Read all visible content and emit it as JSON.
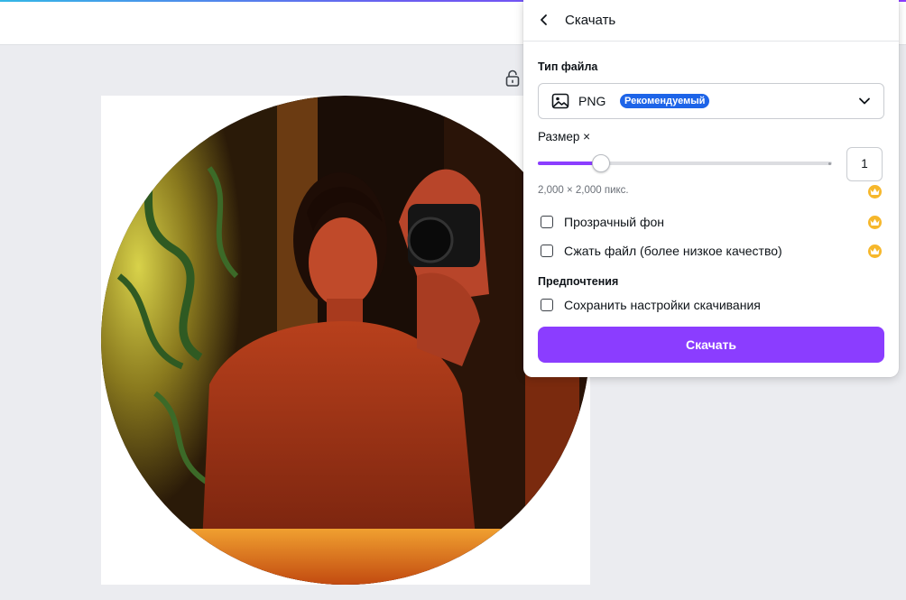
{
  "panel": {
    "title": "Скачать",
    "file_type_label": "Тип файла",
    "file_type_value": "PNG",
    "recommended_badge": "Рекомендуемый",
    "size_label": "Размер ×",
    "size_value": "1",
    "size_slider_fraction": 0.2,
    "dimensions_text": "2,000 × 2,000 пикс.",
    "transparent_bg_label": "Прозрачный фон",
    "transparent_bg_checked": false,
    "compress_label": "Сжать файл (более низкое качество)",
    "compress_checked": false,
    "preferences_label": "Предпочтения",
    "save_settings_label": "Сохранить настройки скачивания",
    "save_settings_checked": false,
    "download_button": "Скачать"
  },
  "icons": {
    "back": "chevron-left-icon",
    "file_type": "image-icon",
    "dropdown": "chevron-down-icon",
    "lock": "unlock-icon",
    "pro": "crown-icon"
  },
  "colors": {
    "accent": "#8b3dff",
    "badge": "#1d64e8",
    "crown": "#f6b72b"
  }
}
